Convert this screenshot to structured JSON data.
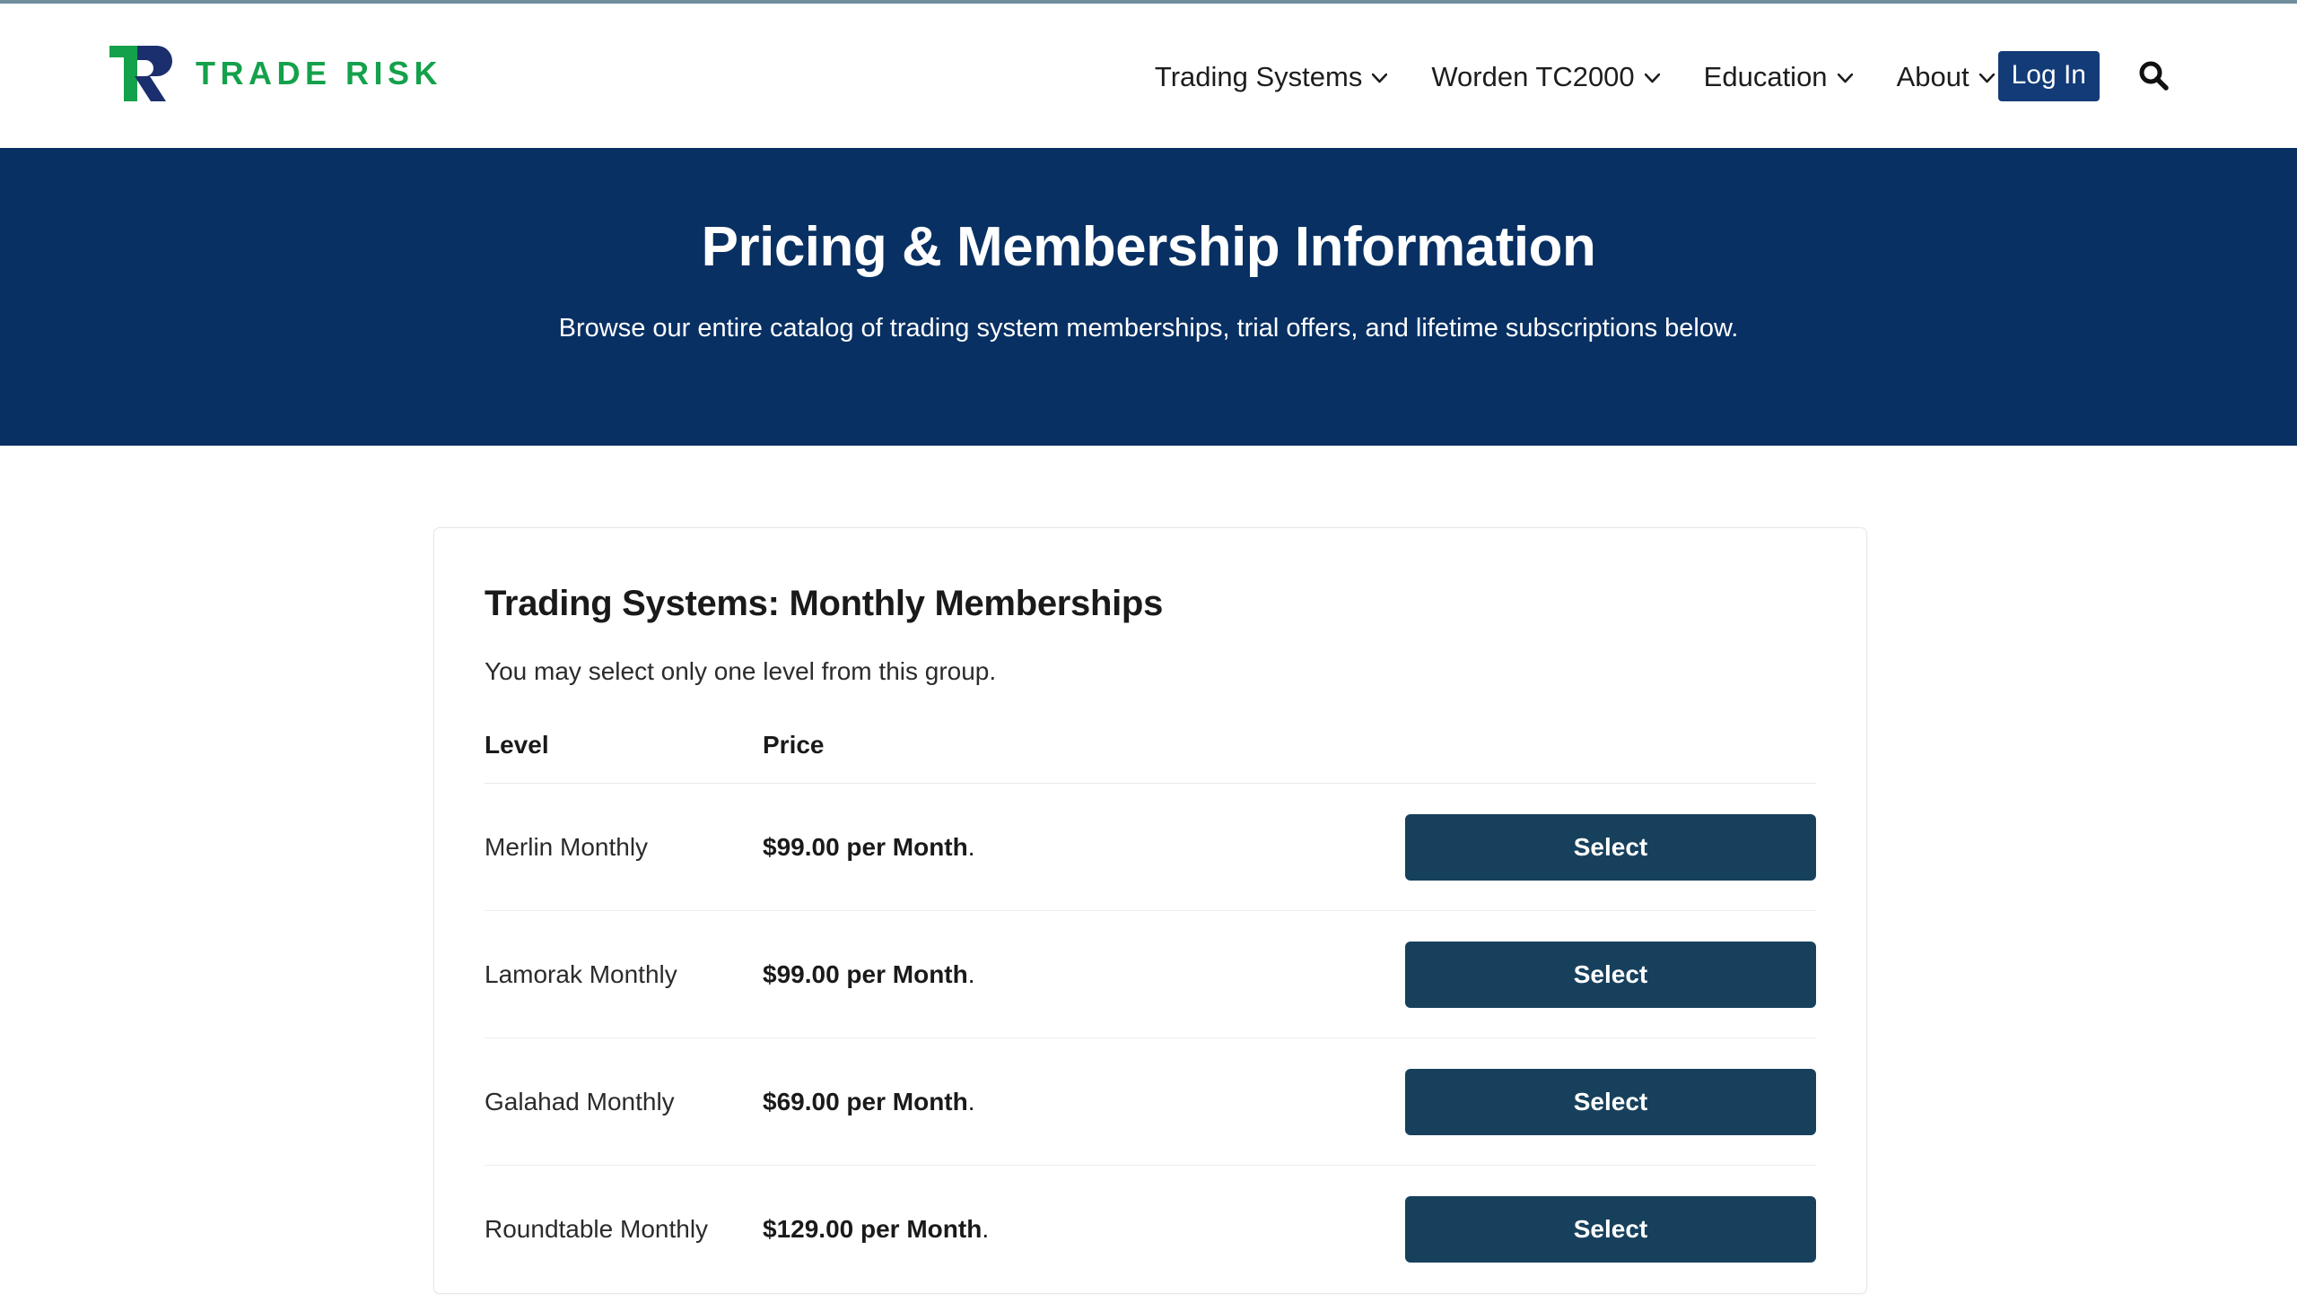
{
  "header": {
    "logo": {
      "mark_alt": "TR monogram",
      "wordmark": "TRADE RISK",
      "green": "#14a14b",
      "navy": "#1b2f6e"
    },
    "nav_items": [
      {
        "label": "Trading Systems",
        "has_caret": true,
        "icon": "chevron-down-icon"
      },
      {
        "label": "Worden TC2000",
        "has_caret": true,
        "icon": "chevron-down-icon"
      },
      {
        "label": "Education",
        "has_caret": true,
        "icon": "chevron-down-icon"
      },
      {
        "label": "About",
        "has_caret": true,
        "icon": "chevron-down-icon"
      }
    ],
    "login_label": "Log In",
    "login_color": "#123b77",
    "search_icon": "search-icon"
  },
  "hero": {
    "title": "Pricing & Membership Information",
    "subtitle": "Browse our entire catalog of trading system memberships, trial offers, and lifetime subscriptions below.",
    "background_color": "#083063",
    "text_color": "#ffffff"
  },
  "card": {
    "title": "Trading Systems: Monthly Memberships",
    "intro": "You may select only one level from this group.",
    "columns": {
      "level": "Level",
      "price": "Price",
      "action": ""
    },
    "select_label": "Select",
    "select_color": "#17405c",
    "rows": [
      {
        "level": "Merlin Monthly",
        "price_amount": "$99.00 per Month",
        "price_suffix": ".",
        "action": "Select"
      },
      {
        "level": "Lamorak Monthly",
        "price_amount": "$99.00 per Month",
        "price_suffix": ".",
        "action": "Select"
      },
      {
        "level": "Galahad Monthly",
        "price_amount": "$69.00 per Month",
        "price_suffix": ".",
        "action": "Select"
      },
      {
        "level": "Roundtable Monthly",
        "price_amount": "$129.00 per Month",
        "price_suffix": ".",
        "action": "Select"
      }
    ]
  }
}
